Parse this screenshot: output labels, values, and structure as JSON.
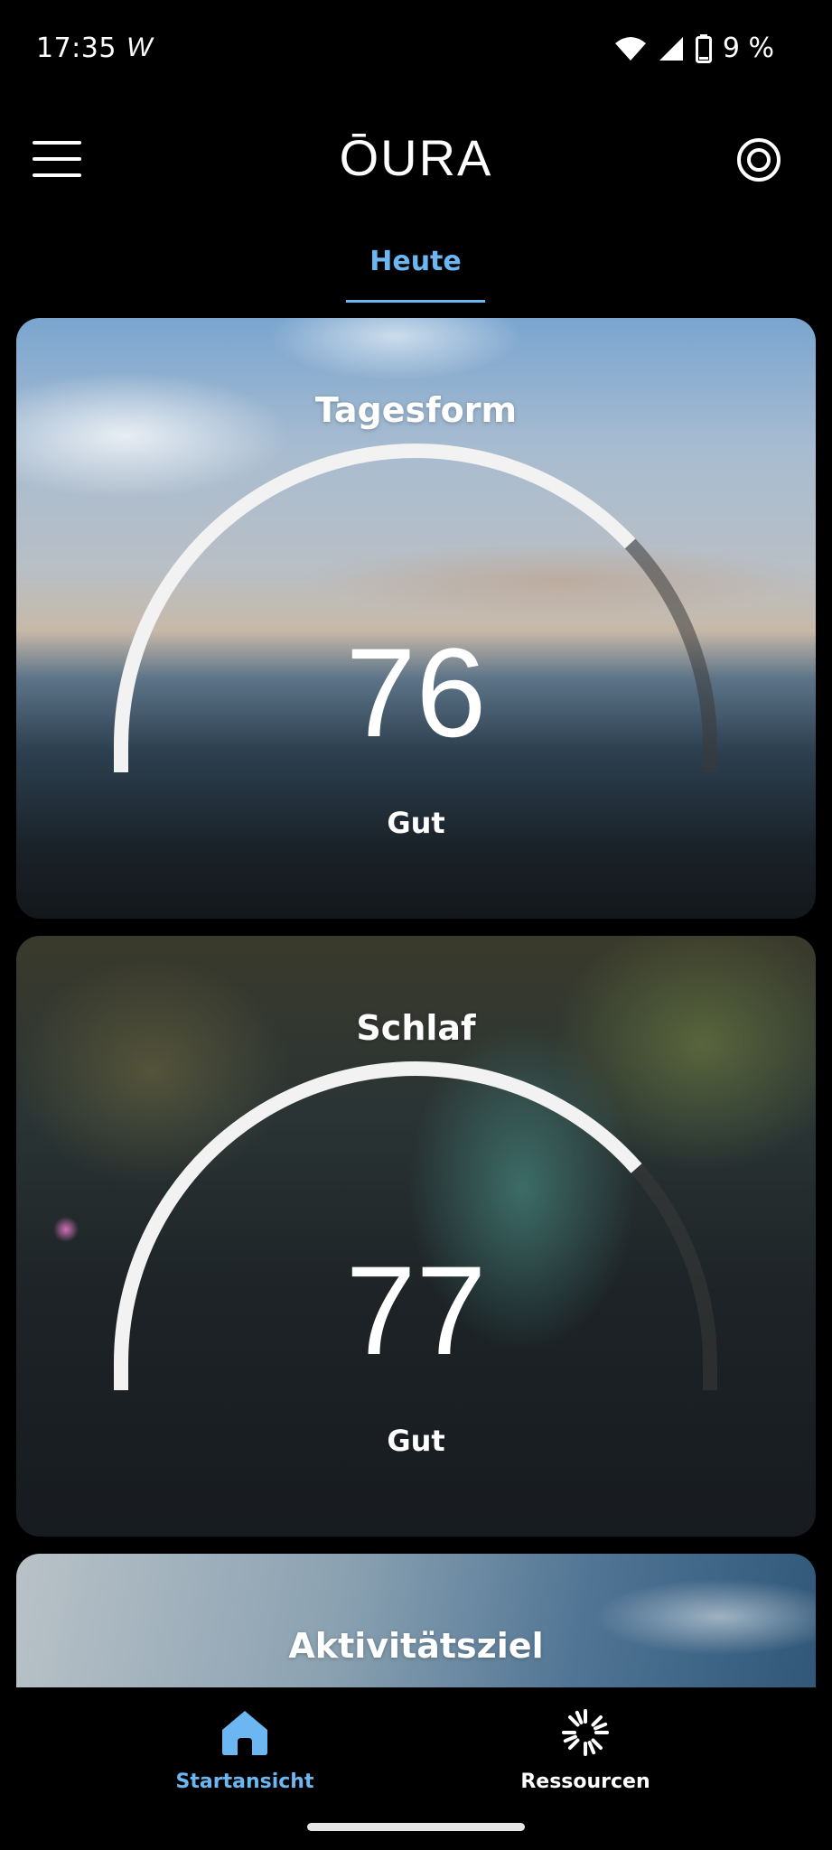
{
  "status_bar": {
    "time": "17:35",
    "app_indicator": "W",
    "battery_text": "9 %",
    "icons": [
      "wifi-icon",
      "signal-icon",
      "battery-icon"
    ]
  },
  "header": {
    "logo": "ŌURA",
    "menu_icon": "hamburger-menu-icon",
    "ring_icon": "ring-icon"
  },
  "tabs": {
    "active": "Heute"
  },
  "cards": [
    {
      "title": "Tagesform",
      "score": "76",
      "rating": "Gut",
      "score_fraction": 0.76,
      "background": "ocean-sky-photo"
    },
    {
      "title": "Schlaf",
      "score": "77",
      "rating": "Gut",
      "score_fraction": 0.77,
      "background": "nebula-photo"
    },
    {
      "title": "Aktivitätsziel",
      "background": "water-texture-photo"
    }
  ],
  "bottom_nav": {
    "items": [
      {
        "label": "Startansicht",
        "icon": "home-icon",
        "active": true
      },
      {
        "label": "Ressourcen",
        "icon": "loader-burst-icon",
        "active": false
      }
    ]
  },
  "colors": {
    "accent": "#6cb6f2",
    "background": "#000000",
    "gauge_fill": "#f2f2f2",
    "gauge_track": "#3a3a3a"
  }
}
